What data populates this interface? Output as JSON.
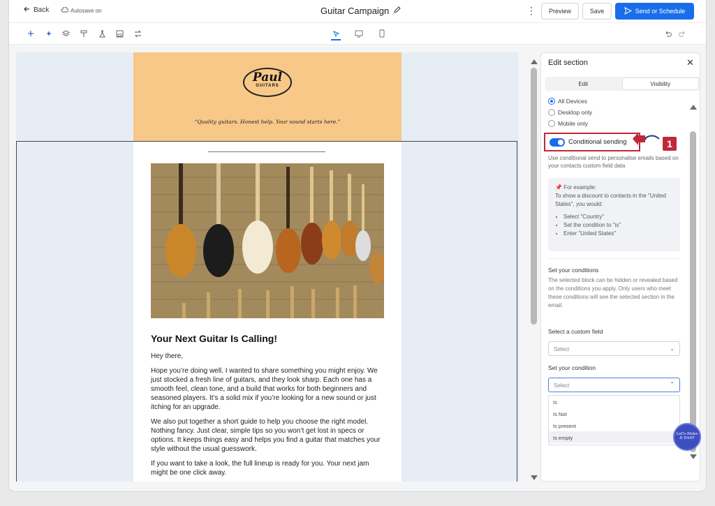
{
  "header": {
    "back_label": "Back",
    "autosave_label": "Autosave on",
    "campaign_title": "Guitar Campaign",
    "preview_label": "Preview",
    "save_label": "Save",
    "send_label": "Send or Schedule"
  },
  "toolbar": {
    "tools": [
      "plus-icon",
      "sparkle-icon",
      "layers-icon",
      "paint-roller-icon",
      "test-icon",
      "floppy-icon",
      "arrows-icon"
    ],
    "devices": [
      "pointer-tool-icon",
      "desktop-icon",
      "mobile-icon"
    ]
  },
  "email": {
    "logo_line1": "Paul",
    "logo_line2": "GUITARS",
    "tagline": "“Quality guitars. Honest help. Your sound starts here.”",
    "heading": "Your Next Guitar Is Calling!",
    "greeting": "Hey there,",
    "para1": "Hope you’re doing well. I wanted to share something you might enjoy. We just stocked a fresh line of guitars, and they look sharp. Each one has a smooth feel, clean tone, and a build that works for both beginners and seasoned players. It’s a solid mix if you’re looking for a new sound or just itching for an upgrade.",
    "para2": "We also put together a short guide to help you choose the right model. Nothing fancy. Just clear, simple tips so you won’t get lost in specs or options. It keeps things easy and helps you find a guitar that matches your style without the usual guesswork.",
    "para3": "If you want to take a look, the full lineup is ready for you. Your next jam might be one click away.",
    "header_bg": "#f7c887"
  },
  "panel": {
    "title": "Edit section",
    "tab_edit": "Edit",
    "tab_visibility": "Visibility",
    "devices_options": [
      "All Devices",
      "Desktop only",
      "Mobile only"
    ],
    "selected_device": "All Devices",
    "conditional_label": "Conditional sending",
    "conditional_on": true,
    "conditional_help": "Use conditional send to personalise emails based on your contacts custom field data",
    "example_title": "📌 For example:",
    "example_text": "To show a discount to contacts in the \"United States\", you would:",
    "example_steps": [
      "Select \"Country\"",
      "Set the condition to \"is\"",
      "Enter \"United States\""
    ],
    "set_conditions_title": "Set your conditions",
    "set_conditions_desc": "The selected block can be hidden or revealed based on the conditions you apply. Only users who meet these conditions will see the selected section in the email.",
    "custom_field_label": "Select a custom field",
    "custom_field_placeholder": "Select",
    "condition_label": "Set your condition",
    "condition_placeholder": "Select",
    "condition_options": [
      "Is",
      "Is Not",
      "Is present",
      "Is empty"
    ],
    "annotation_number": "1",
    "watermark_text": "Let's Make It EASY"
  },
  "colors": {
    "accent": "#1a6dea",
    "highlight": "#c0283a"
  }
}
